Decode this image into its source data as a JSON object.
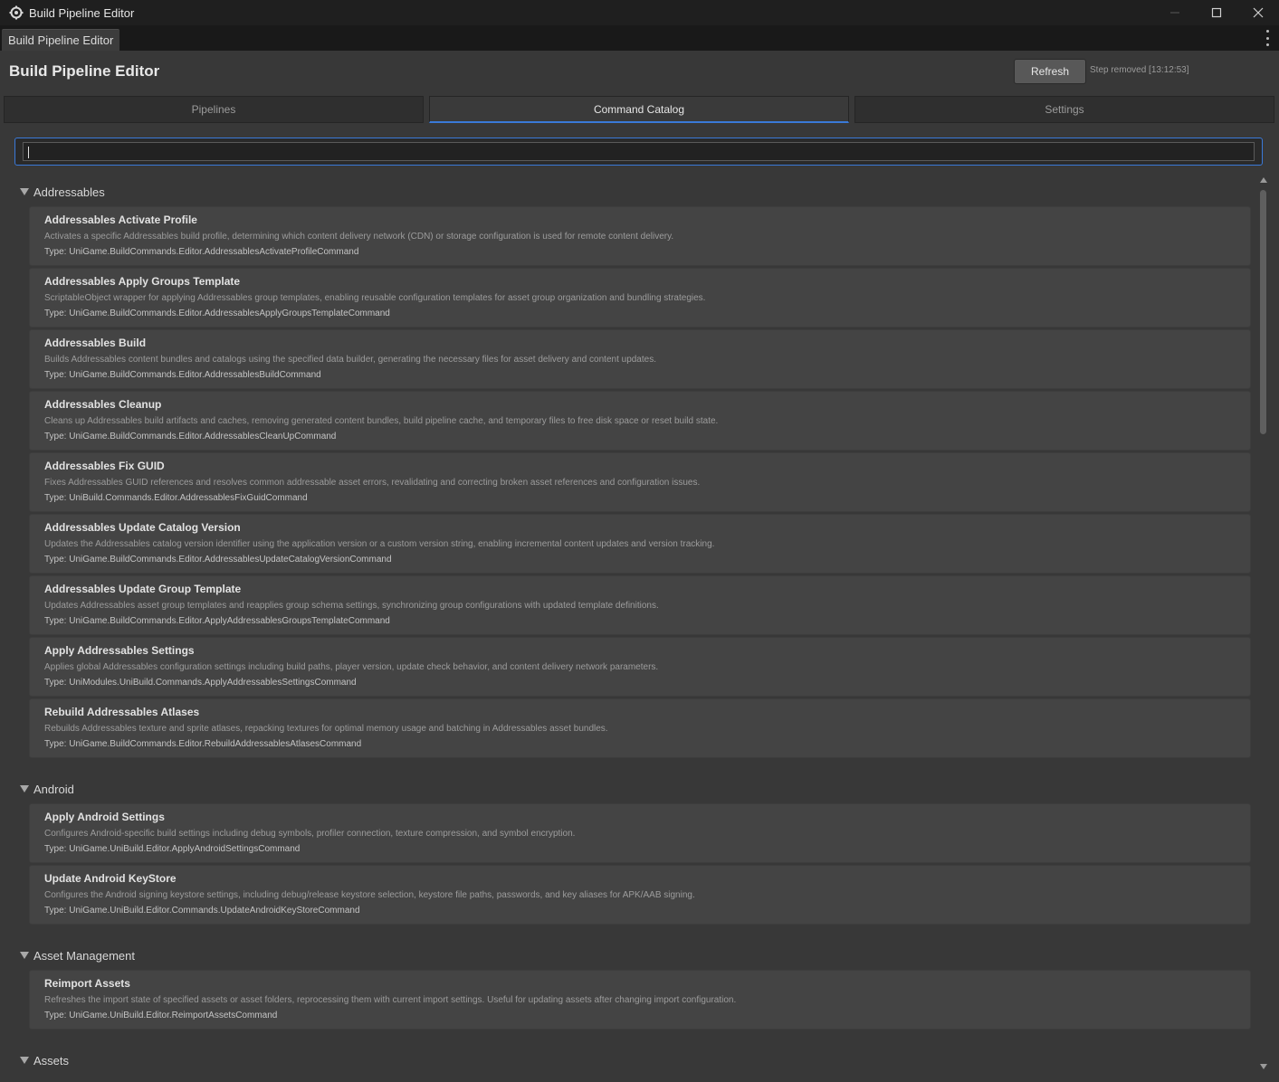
{
  "window": {
    "title": "Build Pipeline Editor",
    "icon": "unity-cog-icon"
  },
  "dock_tab": {
    "label": "Build Pipeline Editor"
  },
  "header": {
    "title": "Build Pipeline Editor",
    "refresh_label": "Refresh",
    "status": "Step removed [13:12:53]"
  },
  "tabs": [
    {
      "label": "Pipelines",
      "active": false
    },
    {
      "label": "Command Catalog",
      "active": true
    },
    {
      "label": "Settings",
      "active": false
    }
  ],
  "search": {
    "value": "",
    "placeholder": ""
  },
  "categories": [
    {
      "name": "Addressables",
      "commands": [
        {
          "name": "Addressables Activate Profile",
          "description": "Activates a specific Addressables build profile, determining which content delivery network (CDN) or storage configuration is used for remote content delivery.",
          "type": "Type: UniGame.BuildCommands.Editor.AddressablesActivateProfileCommand"
        },
        {
          "name": "Addressables Apply Groups Template",
          "description": "ScriptableObject wrapper for applying Addressables group templates, enabling reusable configuration templates for asset group organization and bundling strategies.",
          "type": "Type: UniGame.BuildCommands.Editor.AddressablesApplyGroupsTemplateCommand"
        },
        {
          "name": "Addressables Build",
          "description": "Builds Addressables content bundles and catalogs using the specified data builder, generating the necessary files for asset delivery and content updates.",
          "type": "Type: UniGame.BuildCommands.Editor.AddressablesBuildCommand"
        },
        {
          "name": "Addressables Cleanup",
          "description": "Cleans up Addressables build artifacts and caches, removing generated content bundles, build pipeline cache, and temporary files to free disk space or reset build state.",
          "type": "Type: UniGame.BuildCommands.Editor.AddressablesCleanUpCommand"
        },
        {
          "name": "Addressables Fix GUID",
          "description": "Fixes Addressables GUID references and resolves common addressable asset errors, revalidating and correcting broken asset references and configuration issues.",
          "type": "Type: UniBuild.Commands.Editor.AddressablesFixGuidCommand"
        },
        {
          "name": "Addressables Update Catalog Version",
          "description": "Updates the Addressables catalog version identifier using the application version or a custom version string, enabling incremental content updates and version tracking.",
          "type": "Type: UniGame.BuildCommands.Editor.AddressablesUpdateCatalogVersionCommand"
        },
        {
          "name": "Addressables Update Group Template",
          "description": "Updates Addressables asset group templates and reapplies group schema settings, synchronizing group configurations with updated template definitions.",
          "type": "Type: UniGame.BuildCommands.Editor.ApplyAddressablesGroupsTemplateCommand"
        },
        {
          "name": "Apply Addressables Settings",
          "description": "Applies global Addressables configuration settings including build paths, player version, update check behavior, and content delivery network parameters.",
          "type": "Type: UniModules.UniBuild.Commands.ApplyAddressablesSettingsCommand"
        },
        {
          "name": "Rebuild Addressables Atlases",
          "description": "Rebuilds Addressables texture and sprite atlases, repacking textures for optimal memory usage and batching in Addressables asset bundles.",
          "type": "Type: UniGame.BuildCommands.Editor.RebuildAddressablesAtlasesCommand"
        }
      ]
    },
    {
      "name": "Android",
      "commands": [
        {
          "name": "Apply Android Settings",
          "description": "Configures Android-specific build settings including debug symbols, profiler connection, texture compression, and symbol encryption.",
          "type": "Type: UniGame.UniBuild.Editor.ApplyAndroidSettingsCommand"
        },
        {
          "name": "Update Android KeyStore",
          "description": "Configures the Android signing keystore settings, including debug/release keystore selection, keystore file paths, passwords, and key aliases for APK/AAB signing.",
          "type": "Type: UniGame.UniBuild.Editor.Commands.UpdateAndroidKeyStoreCommand"
        }
      ]
    },
    {
      "name": "Asset Management",
      "commands": [
        {
          "name": "Reimport Assets",
          "description": "Refreshes the import state of specified assets or asset folders, reprocessing them with current import settings. Useful for updating assets after changing import configuration.",
          "type": "Type: UniGame.UniBuild.Editor.ReimportAssetsCommand"
        }
      ]
    },
    {
      "name": "Assets",
      "commands": []
    }
  ],
  "colors": {
    "accent": "#3a79d8",
    "background": "#383838",
    "card": "#444444"
  }
}
